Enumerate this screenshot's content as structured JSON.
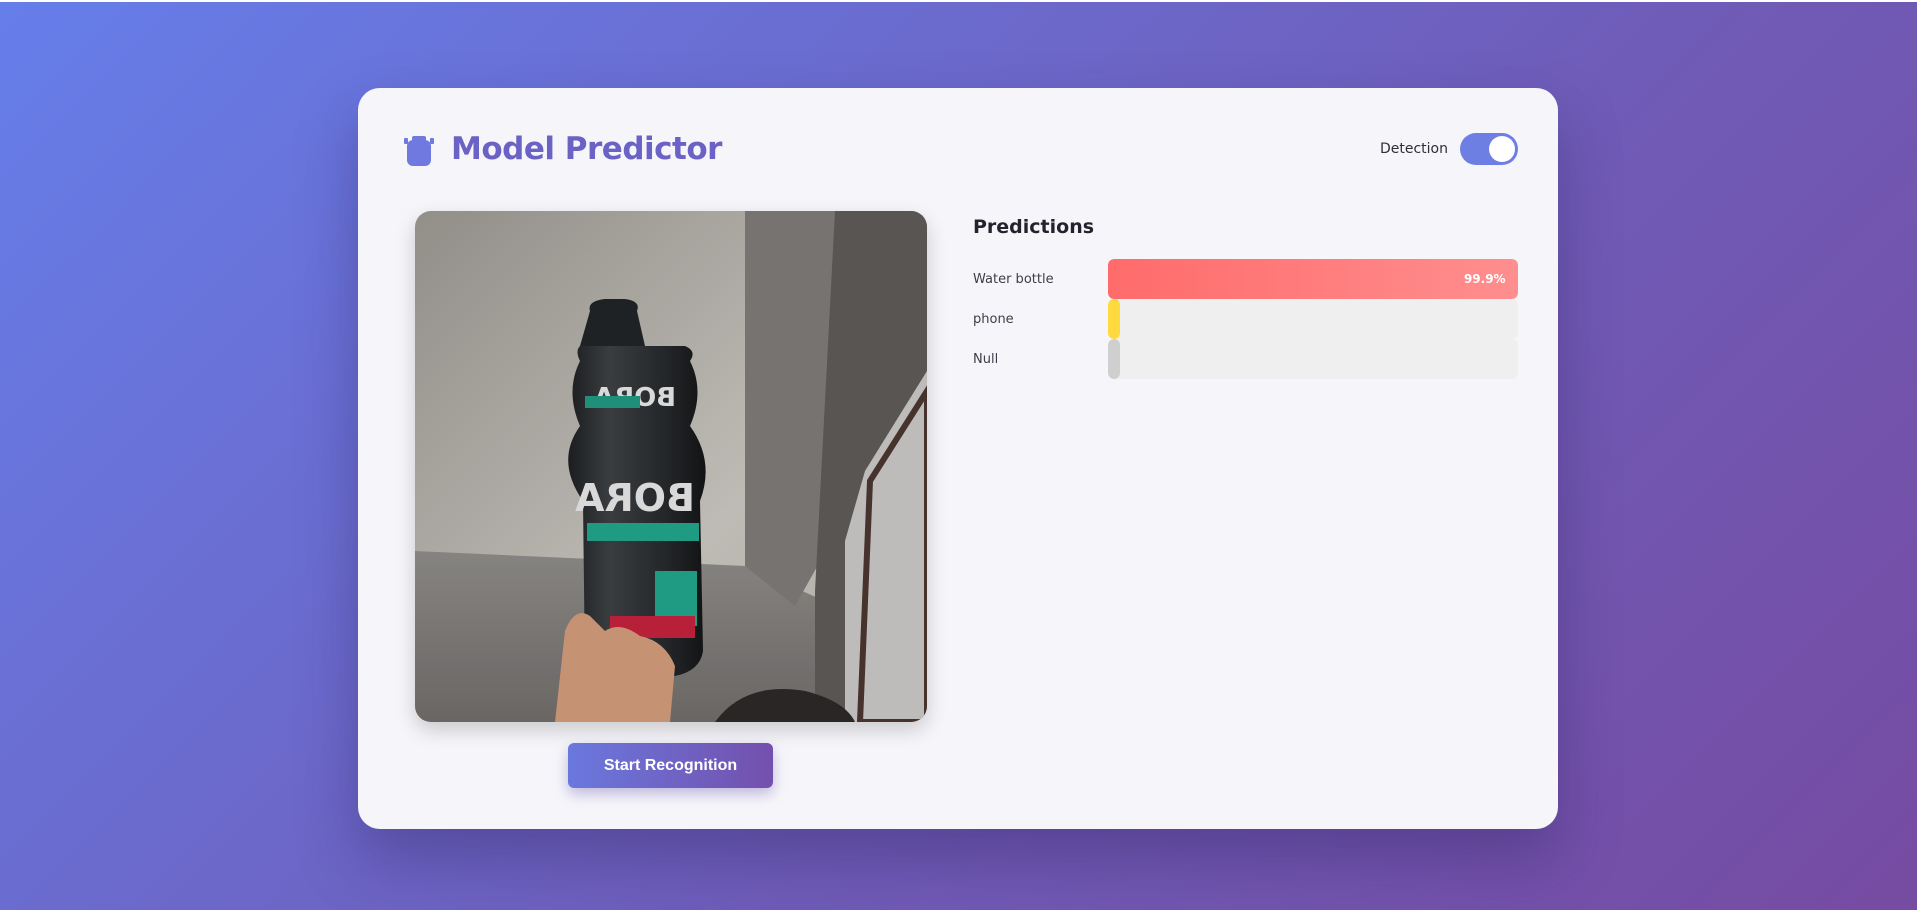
{
  "header": {
    "title": "Model Predictor",
    "logo_icon": "robot-icon"
  },
  "detection": {
    "label": "Detection",
    "enabled": true
  },
  "camera": {
    "description_icon": "camera-feed"
  },
  "actions": {
    "start_label": "Start Recognition"
  },
  "predictions": {
    "title": "Predictions",
    "items": [
      {
        "label": "Water bottle",
        "value_text": "99.9%",
        "fraction": 0.999,
        "color": "#ff6b6b"
      },
      {
        "label": "phone",
        "value_text": "",
        "fraction": 0.001,
        "color": "#ffd93d"
      },
      {
        "label": "Null",
        "value_text": "",
        "fraction": 0.0,
        "color": "#cfcfcf"
      }
    ]
  },
  "colors": {
    "accent": "#667eea",
    "accent_dark": "#764ba2",
    "toggle_on": "#6e7fe3"
  }
}
